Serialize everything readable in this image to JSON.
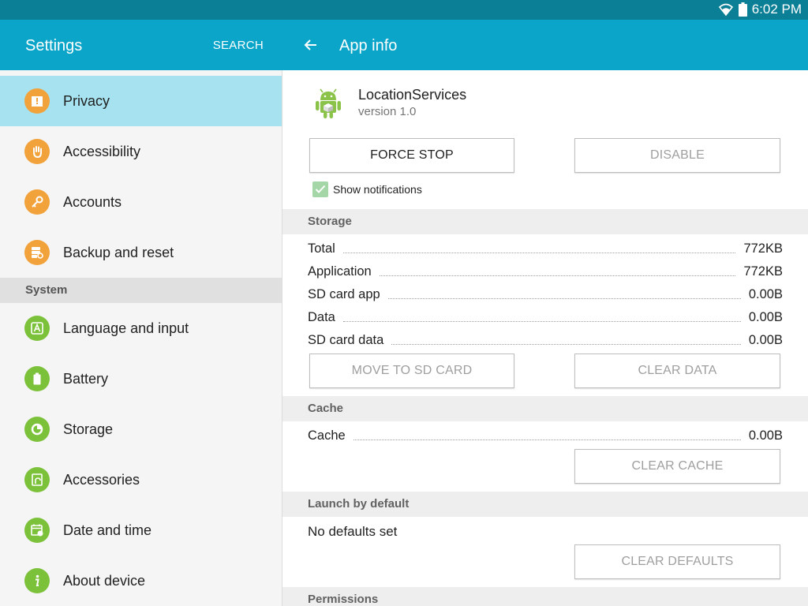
{
  "status_bar": {
    "time": "6:02 PM"
  },
  "sidebar": {
    "title": "Settings",
    "search_label": "SEARCH",
    "items_top": [
      {
        "label": "Privacy",
        "icon": "privacy-icon"
      },
      {
        "label": "Accessibility",
        "icon": "hand-icon"
      },
      {
        "label": "Accounts",
        "icon": "key-icon"
      },
      {
        "label": "Backup and reset",
        "icon": "backup-icon"
      }
    ],
    "system_header": "System",
    "items_system": [
      {
        "label": "Language and input",
        "icon": "language-icon"
      },
      {
        "label": "Battery",
        "icon": "battery-icon"
      },
      {
        "label": "Storage",
        "icon": "storage-icon"
      },
      {
        "label": "Accessories",
        "icon": "accessories-icon"
      },
      {
        "label": "Date and time",
        "icon": "calendar-icon"
      },
      {
        "label": "About device",
        "icon": "info-icon"
      }
    ]
  },
  "app_info": {
    "title": "App info",
    "app_name": "LocationServices",
    "version": "version 1.0",
    "force_stop": "FORCE STOP",
    "disable": "DISABLE",
    "show_notifications": "Show notifications",
    "storage_header": "Storage",
    "storage_rows": [
      {
        "label": "Total",
        "value": "772KB"
      },
      {
        "label": "Application",
        "value": "772KB"
      },
      {
        "label": "SD card app",
        "value": "0.00B"
      },
      {
        "label": "Data",
        "value": "0.00B"
      },
      {
        "label": "SD card data",
        "value": "0.00B"
      }
    ],
    "move_to_sd": "MOVE TO SD CARD",
    "clear_data": "CLEAR DATA",
    "cache_header": "Cache",
    "cache_row": {
      "label": "Cache",
      "value": "0.00B"
    },
    "clear_cache": "CLEAR CACHE",
    "launch_header": "Launch by default",
    "no_defaults": "No defaults set",
    "clear_defaults": "CLEAR DEFAULTS",
    "permissions_header": "Permissions"
  },
  "colors": {
    "header": "#0aa5c9",
    "status_bar": "#0b7f95",
    "selected": "#a6e2ef",
    "icon_orange": "#f2a23b",
    "icon_green": "#7cc13a"
  }
}
